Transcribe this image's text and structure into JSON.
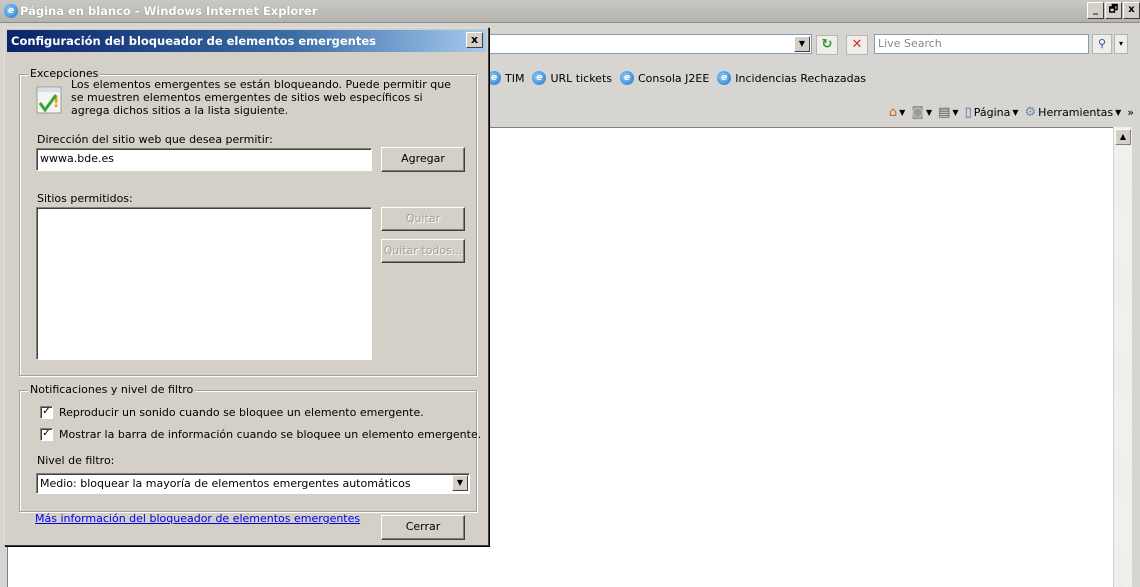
{
  "ie": {
    "title": "Página en blanco - Windows Internet Explorer",
    "window_buttons": [
      "_",
      "🗗",
      "x"
    ],
    "search_placeholder": "Live Search",
    "favorites": [
      "TIM",
      "URL tickets",
      "Consola J2EE",
      "Incidencias Rechazadas"
    ],
    "commands": {
      "pagina": "Página",
      "herramientas": "Herramientas",
      "more": "»"
    }
  },
  "dialog": {
    "title": "Configuración del bloqueador de elementos emergentes",
    "close": "x",
    "exceptions": {
      "legend": "Excepciones",
      "info": "Los elementos emergentes se están bloqueando. Puede permitir que se muestren elementos emergentes de sitios web específicos si agrega dichos sitios a la lista siguiente.",
      "address_label": "Dirección del sitio web que desea permitir:",
      "address_value": "wwwa.bde.es",
      "add_button": "Agregar",
      "allowed_label": "Sitios permitidos:",
      "remove_button": "Quitar",
      "remove_all_button": "Quitar todos..."
    },
    "notifications": {
      "legend": "Notificaciones y nivel de filtro",
      "sound_label": "Reproducir un sonido cuando se bloquee un elemento emergente.",
      "sound_checked": true,
      "infobar_label": "Mostrar la barra de información cuando se bloquee un elemento emergente.",
      "infobar_checked": true,
      "filter_label": "Nivel de filtro:",
      "filter_value": "Medio: bloquear la mayoría de elementos emergentes automáticos"
    },
    "more_info_link": "Más información del bloqueador de elementos emergentes",
    "close_button": "Cerrar"
  }
}
